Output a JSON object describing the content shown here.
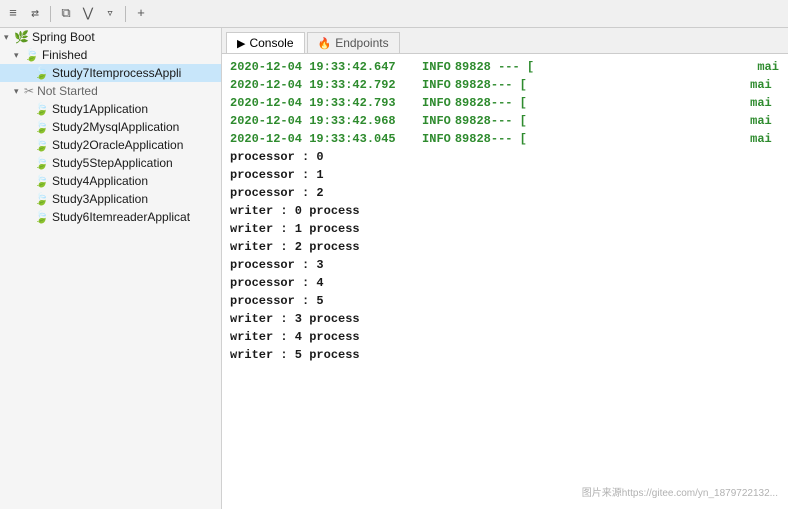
{
  "toolbar": {
    "icons": [
      "≡",
      "≡",
      "⊞",
      "⊽",
      "⊡",
      "+"
    ]
  },
  "leftPanel": {
    "springBoot": {
      "label": "Spring Boot",
      "children": [
        {
          "label": "Finished",
          "expanded": true,
          "children": [
            {
              "label": "Study7ItemprocessAppli",
              "selected": true
            }
          ]
        },
        {
          "label": "Not Started",
          "expanded": true,
          "children": [
            {
              "label": "Study1Application"
            },
            {
              "label": "Study2MysqlApplication"
            },
            {
              "label": "Study2OracleApplication"
            },
            {
              "label": "Study5StepApplication"
            },
            {
              "label": "Study4Application"
            },
            {
              "label": "Study3Application"
            },
            {
              "label": "Study6ItemreaderApplicat"
            }
          ]
        }
      ]
    }
  },
  "tabs": [
    {
      "label": "Console",
      "icon": "▶",
      "active": true
    },
    {
      "label": "Endpoints",
      "icon": "🔥",
      "active": false
    }
  ],
  "console": {
    "logLines": [
      {
        "timestamp": "2020-12-04 19:33:42.647",
        "level": "INFO",
        "pid": "89828",
        "rest": "--- [",
        "thread": "mai"
      },
      {
        "timestamp": "2020-12-04 19:33:42.792",
        "level": "INFO",
        "pid": "89828",
        "rest": "--- [",
        "thread": "mai"
      },
      {
        "timestamp": "2020-12-04 19:33:42.793",
        "level": "INFO",
        "pid": "89828",
        "rest": "--- [",
        "thread": "mai"
      },
      {
        "timestamp": "2020-12-04 19:33:42.968",
        "level": "INFO",
        "pid": "89828",
        "rest": "--- [",
        "thread": "mai"
      },
      {
        "timestamp": "2020-12-04 19:33:43.045",
        "level": "INFO",
        "pid": "89828",
        "rest": "--- [",
        "thread": "mai"
      }
    ],
    "procLines": [
      "processor : 0",
      "processor : 1",
      "processor : 2",
      "writer : 0 process",
      "writer : 1 process",
      "writer : 2 process",
      "processor : 3",
      "processor : 4",
      "processor : 5",
      "writer : 3 process",
      "writer : 4 process",
      "writer : 5 process"
    ]
  },
  "watermark": "图片来源https://gitee.com/yn_1879722132..."
}
